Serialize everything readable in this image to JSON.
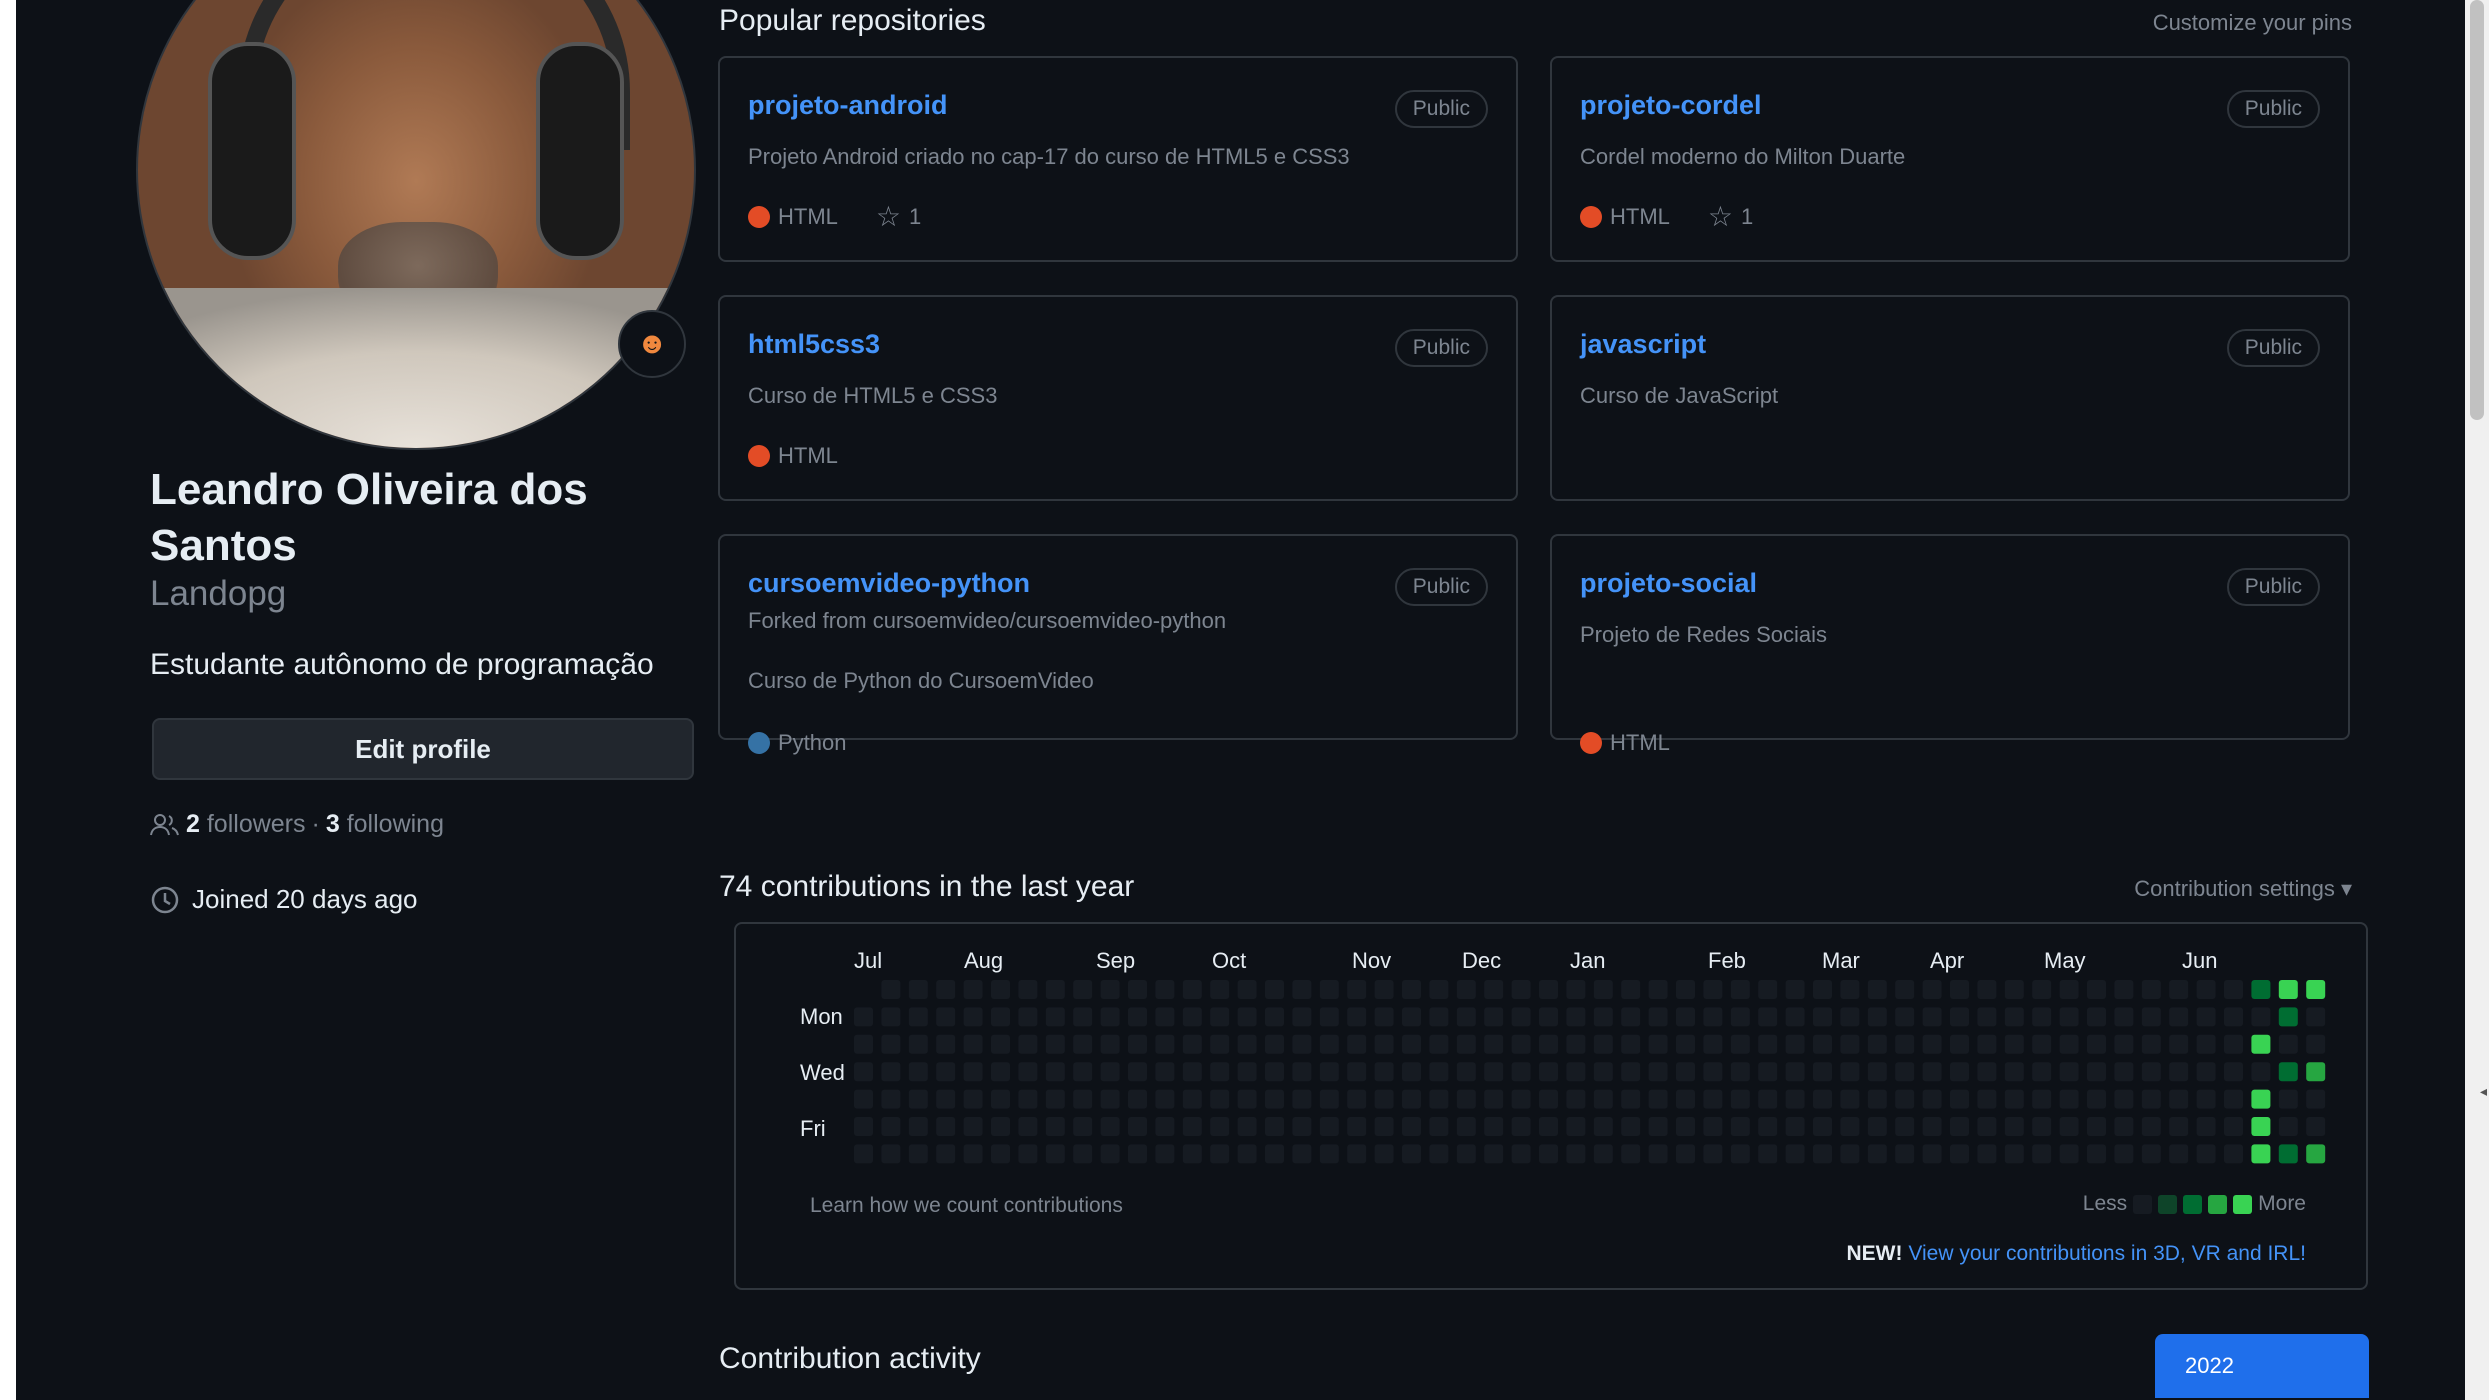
{
  "profile": {
    "name": "Leandro Oliveira dos Santos",
    "username": "Landopg",
    "bio": "Estudante autônomo de programação",
    "edit_label": "Edit profile",
    "followers_count": "2",
    "followers_label": "followers",
    "separator": "·",
    "following_count": "3",
    "following_label": "following",
    "joined": "Joined 20 days ago",
    "avatar_icon": "user-photo",
    "status_emoji_icon": "smiley-icon"
  },
  "pinned": {
    "title": "Popular repositories",
    "customize_label": "Customize your pins",
    "repos": [
      {
        "name": "projeto-android",
        "visibility": "Public",
        "forked_from": "",
        "description": "Projeto Android criado no cap-17 do curso de HTML5 e CSS3",
        "language": "HTML",
        "lang_color": "#e34c26",
        "stars": "1"
      },
      {
        "name": "projeto-cordel",
        "visibility": "Public",
        "forked_from": "",
        "description": "Cordel moderno do Milton Duarte",
        "language": "HTML",
        "lang_color": "#e34c26",
        "stars": "1"
      },
      {
        "name": "html5css3",
        "visibility": "Public",
        "forked_from": "",
        "description": "Curso de HTML5 e CSS3",
        "language": "HTML",
        "lang_color": "#e34c26",
        "stars": ""
      },
      {
        "name": "javascript",
        "visibility": "Public",
        "forked_from": "",
        "description": "Curso de JavaScript",
        "language": "",
        "lang_color": "",
        "stars": ""
      },
      {
        "name": "cursoemvideo-python",
        "visibility": "Public",
        "forked_from": "Forked from cursoemvideo/cursoemvideo-python",
        "description": "Curso de Python do CursoemVideo",
        "language": "Python",
        "lang_color": "#3572a5",
        "stars": ""
      },
      {
        "name": "projeto-social",
        "visibility": "Public",
        "forked_from": "",
        "description": "Projeto de Redes Sociais",
        "language": "HTML",
        "lang_color": "#e34c26",
        "stars": ""
      }
    ]
  },
  "contributions": {
    "title": "74 contributions in the last year",
    "settings_label": "Contribution settings",
    "months": [
      "Jul",
      "Aug",
      "Sep",
      "Oct",
      "Nov",
      "Dec",
      "Jan",
      "Feb",
      "Mar",
      "Apr",
      "May",
      "Jun"
    ],
    "day_labels": [
      "Mon",
      "Wed",
      "Fri"
    ],
    "learn_label": "Learn how we count contributions",
    "legend_less": "Less",
    "legend_more": "More",
    "legend_colors": [
      "#161b22",
      "#0e4429",
      "#006d32",
      "#26a641",
      "#39d353"
    ],
    "news_new": "NEW!",
    "news_link": "View your contributions in 3D, VR and IRL!",
    "active_cells": [
      {
        "week": 51,
        "day": 0,
        "level": 2
      },
      {
        "week": 52,
        "day": 0,
        "level": 4
      },
      {
        "week": 53,
        "day": 0,
        "level": 4
      },
      {
        "week": 52,
        "day": 1,
        "level": 2
      },
      {
        "week": 51,
        "day": 2,
        "level": 4
      },
      {
        "week": 52,
        "day": 3,
        "level": 2
      },
      {
        "week": 53,
        "day": 3,
        "level": 3
      },
      {
        "week": 51,
        "day": 4,
        "level": 4
      },
      {
        "week": 51,
        "day": 5,
        "level": 4
      },
      {
        "week": 51,
        "day": 6,
        "level": 4
      },
      {
        "week": 52,
        "day": 6,
        "level": 2
      },
      {
        "week": 53,
        "day": 6,
        "level": 3
      }
    ]
  },
  "activity": {
    "title": "Contribution activity",
    "year": "2022"
  }
}
